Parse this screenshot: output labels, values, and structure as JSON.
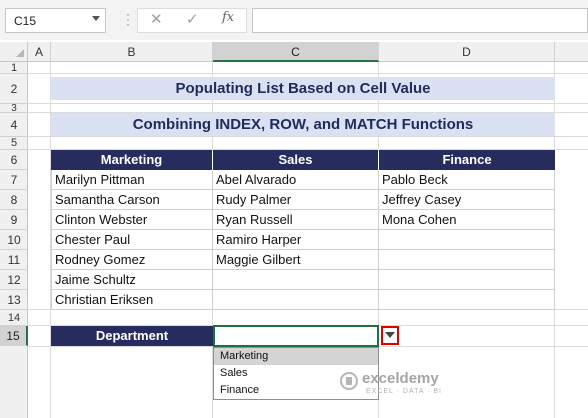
{
  "formula_bar": {
    "name_box": "C15",
    "fx_label": "fx",
    "cancel_glyph": "✕",
    "enter_glyph": "✓",
    "formula": ""
  },
  "columns": [
    "A",
    "B",
    "C",
    "D"
  ],
  "rows": [
    "1",
    "2",
    "3",
    "4",
    "5",
    "6",
    "7",
    "8",
    "9",
    "10",
    "11",
    "12",
    "13",
    "14",
    "15"
  ],
  "selected": {
    "column": "C",
    "row": "15"
  },
  "title": "Populating List Based on Cell Value",
  "subtitle": "Combining INDEX, ROW, and MATCH Functions",
  "table": {
    "headers": [
      "Marketing",
      "Sales",
      "Finance"
    ],
    "rows": [
      [
        "Marilyn Pittman",
        "Abel Alvarado",
        "Pablo Beck"
      ],
      [
        "Samantha Carson",
        "Rudy Palmer",
        "Jeffrey Casey"
      ],
      [
        "Clinton Webster",
        "Ryan Russell",
        "Mona Cohen"
      ],
      [
        "Chester Paul",
        "Ramiro Harper",
        ""
      ],
      [
        "Rodney Gomez",
        "Maggie Gilbert",
        ""
      ],
      [
        "Jaime Schultz",
        "",
        ""
      ],
      [
        "Christian Eriksen",
        "",
        ""
      ]
    ]
  },
  "department": {
    "label": "Department",
    "value": ""
  },
  "dropdown": {
    "options": [
      "Marketing",
      "Sales",
      "Finance"
    ],
    "highlighted": "Marketing"
  },
  "watermark": {
    "name": "exceldemy",
    "tagline": "EXCEL · DATA · BI"
  },
  "colors": {
    "header_navy": "#262c5e",
    "banner_fill": "#d9e1f2",
    "selection_green": "#217346",
    "dropdown_highlight_border": "#e00000"
  }
}
